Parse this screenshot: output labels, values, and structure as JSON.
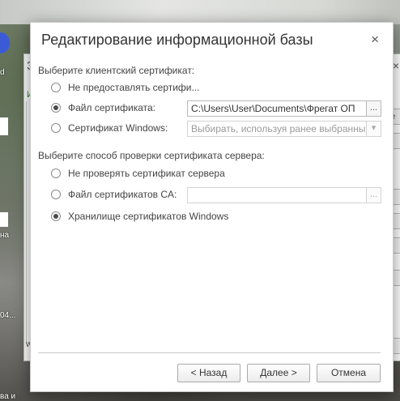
{
  "desktop": {
    "labels": [
      "d",
      "на",
      "04...",
      "ва и"
    ]
  },
  "back_window": {
    "title_char": "З",
    "close_glyph": "×",
    "tab_char": "И",
    "bottom_char": "w",
    "button_chars": [
      "e",
      "",
      "",
      "",
      "",
      "",
      ""
    ]
  },
  "dialog": {
    "title": "Редактирование информационной базы",
    "close_glyph": "×",
    "client_cert": {
      "section_label": "Выберите клиентский сертификат:",
      "options": [
        {
          "label": "Не предоставлять сертифи...",
          "selected": false
        },
        {
          "label": "Файл сертификата:",
          "selected": true
        },
        {
          "label": "Сертификат Windows:",
          "selected": false
        }
      ],
      "file_value": "C:\\Users\\User\\Documents\\Фрегат ОП",
      "browse_label": "...",
      "windows_placeholder": "Выбирать, используя ранее выбранный",
      "dropdown_glyph": "▾"
    },
    "server_cert": {
      "section_label": "Выберите способ проверки сертификата сервера:",
      "options": [
        {
          "label": "Не проверять сертификат сервера",
          "selected": false
        },
        {
          "label": "Файл сертификатов CA:",
          "selected": false
        },
        {
          "label": "Хранилище сертификатов Windows",
          "selected": true
        }
      ],
      "ca_value": "",
      "browse_label": "..."
    },
    "buttons": {
      "back": "< Назад",
      "next": "Далее >",
      "cancel": "Отмена"
    }
  }
}
